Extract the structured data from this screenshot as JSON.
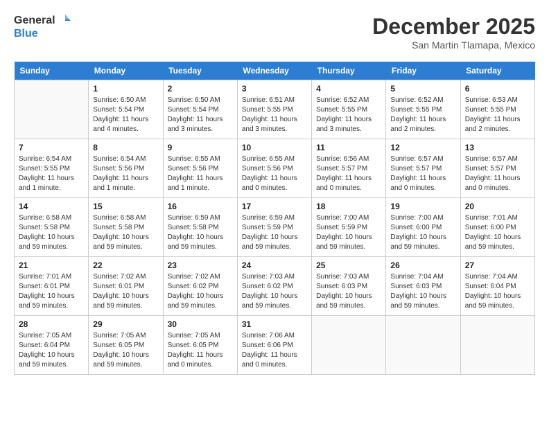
{
  "header": {
    "logo_line1": "General",
    "logo_line2": "Blue",
    "month": "December 2025",
    "location": "San Martin Tlamapa, Mexico"
  },
  "weekdays": [
    "Sunday",
    "Monday",
    "Tuesday",
    "Wednesday",
    "Thursday",
    "Friday",
    "Saturday"
  ],
  "weeks": [
    [
      {
        "day": "",
        "info": ""
      },
      {
        "day": "1",
        "info": "Sunrise: 6:50 AM\nSunset: 5:54 PM\nDaylight: 11 hours\nand 4 minutes."
      },
      {
        "day": "2",
        "info": "Sunrise: 6:50 AM\nSunset: 5:54 PM\nDaylight: 11 hours\nand 3 minutes."
      },
      {
        "day": "3",
        "info": "Sunrise: 6:51 AM\nSunset: 5:55 PM\nDaylight: 11 hours\nand 3 minutes."
      },
      {
        "day": "4",
        "info": "Sunrise: 6:52 AM\nSunset: 5:55 PM\nDaylight: 11 hours\nand 3 minutes."
      },
      {
        "day": "5",
        "info": "Sunrise: 6:52 AM\nSunset: 5:55 PM\nDaylight: 11 hours\nand 2 minutes."
      },
      {
        "day": "6",
        "info": "Sunrise: 6:53 AM\nSunset: 5:55 PM\nDaylight: 11 hours\nand 2 minutes."
      }
    ],
    [
      {
        "day": "7",
        "info": "Sunrise: 6:54 AM\nSunset: 5:55 PM\nDaylight: 11 hours\nand 1 minute."
      },
      {
        "day": "8",
        "info": "Sunrise: 6:54 AM\nSunset: 5:56 PM\nDaylight: 11 hours\nand 1 minute."
      },
      {
        "day": "9",
        "info": "Sunrise: 6:55 AM\nSunset: 5:56 PM\nDaylight: 11 hours\nand 1 minute."
      },
      {
        "day": "10",
        "info": "Sunrise: 6:55 AM\nSunset: 5:56 PM\nDaylight: 11 hours\nand 0 minutes."
      },
      {
        "day": "11",
        "info": "Sunrise: 6:56 AM\nSunset: 5:57 PM\nDaylight: 11 hours\nand 0 minutes."
      },
      {
        "day": "12",
        "info": "Sunrise: 6:57 AM\nSunset: 5:57 PM\nDaylight: 11 hours\nand 0 minutes."
      },
      {
        "day": "13",
        "info": "Sunrise: 6:57 AM\nSunset: 5:57 PM\nDaylight: 11 hours\nand 0 minutes."
      }
    ],
    [
      {
        "day": "14",
        "info": "Sunrise: 6:58 AM\nSunset: 5:58 PM\nDaylight: 10 hours\nand 59 minutes."
      },
      {
        "day": "15",
        "info": "Sunrise: 6:58 AM\nSunset: 5:58 PM\nDaylight: 10 hours\nand 59 minutes."
      },
      {
        "day": "16",
        "info": "Sunrise: 6:59 AM\nSunset: 5:58 PM\nDaylight: 10 hours\nand 59 minutes."
      },
      {
        "day": "17",
        "info": "Sunrise: 6:59 AM\nSunset: 5:59 PM\nDaylight: 10 hours\nand 59 minutes."
      },
      {
        "day": "18",
        "info": "Sunrise: 7:00 AM\nSunset: 5:59 PM\nDaylight: 10 hours\nand 59 minutes."
      },
      {
        "day": "19",
        "info": "Sunrise: 7:00 AM\nSunset: 6:00 PM\nDaylight: 10 hours\nand 59 minutes."
      },
      {
        "day": "20",
        "info": "Sunrise: 7:01 AM\nSunset: 6:00 PM\nDaylight: 10 hours\nand 59 minutes."
      }
    ],
    [
      {
        "day": "21",
        "info": "Sunrise: 7:01 AM\nSunset: 6:01 PM\nDaylight: 10 hours\nand 59 minutes."
      },
      {
        "day": "22",
        "info": "Sunrise: 7:02 AM\nSunset: 6:01 PM\nDaylight: 10 hours\nand 59 minutes."
      },
      {
        "day": "23",
        "info": "Sunrise: 7:02 AM\nSunset: 6:02 PM\nDaylight: 10 hours\nand 59 minutes."
      },
      {
        "day": "24",
        "info": "Sunrise: 7:03 AM\nSunset: 6:02 PM\nDaylight: 10 hours\nand 59 minutes."
      },
      {
        "day": "25",
        "info": "Sunrise: 7:03 AM\nSunset: 6:03 PM\nDaylight: 10 hours\nand 59 minutes."
      },
      {
        "day": "26",
        "info": "Sunrise: 7:04 AM\nSunset: 6:03 PM\nDaylight: 10 hours\nand 59 minutes."
      },
      {
        "day": "27",
        "info": "Sunrise: 7:04 AM\nSunset: 6:04 PM\nDaylight: 10 hours\nand 59 minutes."
      }
    ],
    [
      {
        "day": "28",
        "info": "Sunrise: 7:05 AM\nSunset: 6:04 PM\nDaylight: 10 hours\nand 59 minutes."
      },
      {
        "day": "29",
        "info": "Sunrise: 7:05 AM\nSunset: 6:05 PM\nDaylight: 10 hours\nand 59 minutes."
      },
      {
        "day": "30",
        "info": "Sunrise: 7:05 AM\nSunset: 6:05 PM\nDaylight: 11 hours\nand 0 minutes."
      },
      {
        "day": "31",
        "info": "Sunrise: 7:06 AM\nSunset: 6:06 PM\nDaylight: 11 hours\nand 0 minutes."
      },
      {
        "day": "",
        "info": ""
      },
      {
        "day": "",
        "info": ""
      },
      {
        "day": "",
        "info": ""
      }
    ]
  ]
}
